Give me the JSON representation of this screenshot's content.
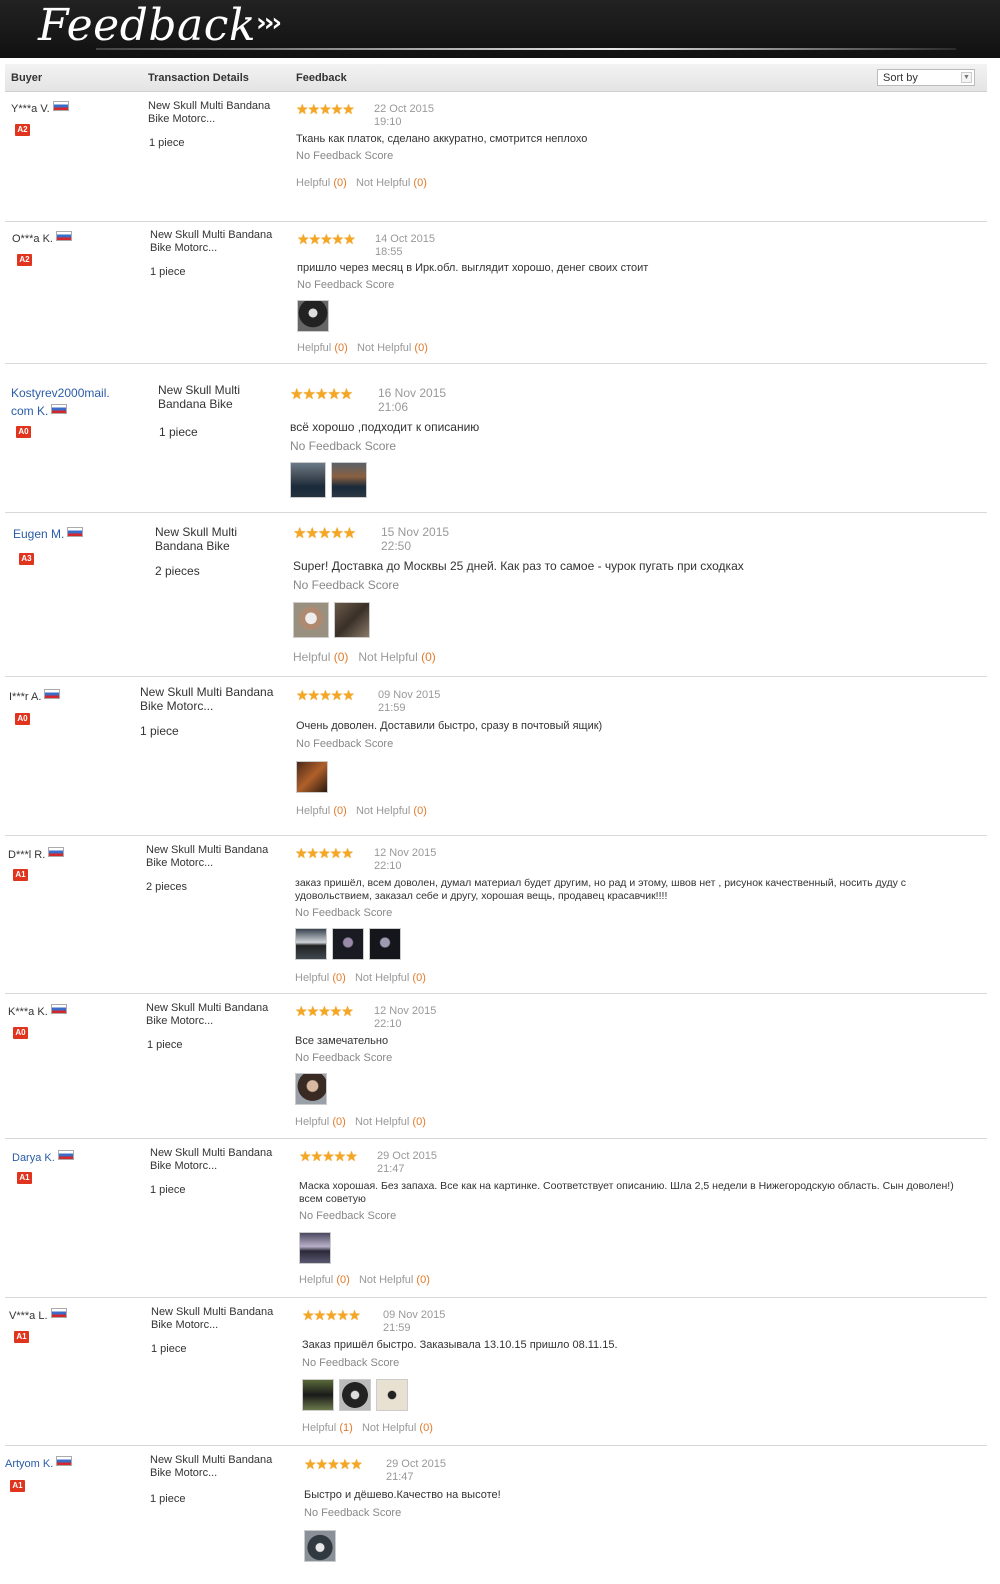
{
  "banner": {
    "title": "Feedback",
    "arrows": "›››"
  },
  "table_header": {
    "buyer": "Buyer",
    "transaction": "Transaction Details",
    "feedback": "Feedback",
    "sort": "Sort by"
  },
  "stars": "★★★★★",
  "helpful_label": "Helpful",
  "not_helpful_label": "Not Helpful",
  "reviews": [
    {
      "buyer": "Y***a V.",
      "level": "A2",
      "product": "New Skull Multi Bandana Bike Motorc...",
      "qty": "1 piece",
      "date": "22 Oct 2015",
      "time": "19:10",
      "comment": "Ткань как платок, сделано аккуратно, смотрится неплохо",
      "score": "No Feedback Score",
      "helpful": "(0)",
      "not_helpful": "(0)"
    },
    {
      "buyer": "O***a K.",
      "level": "A2",
      "product": "New Skull Multi Bandana Bike Motorc...",
      "qty": "1 piece",
      "date": "14 Oct 2015",
      "time": "18:55",
      "comment": "пришло через месяц в Ирк.обл. выглядит хорошо, денег своих стоит",
      "score": "No Feedback Score",
      "helpful": "(0)",
      "not_helpful": "(0)"
    },
    {
      "buyer": "Kostyrev2000mail.",
      "buyer2": "com K.",
      "level": "A0",
      "product": "New Skull Multi Bandana Bike",
      "qty": "1 piece",
      "date": "16 Nov 2015",
      "time": "21:06",
      "comment": "всё хорошо ,подходит к описанию",
      "score": "No Feedback Score",
      "helpful": "",
      "not_helpful": ""
    },
    {
      "buyer": "Eugen M.",
      "level": "A3",
      "product": "New Skull Multi Bandana Bike",
      "qty": "2 pieces",
      "date": "15 Nov 2015",
      "time": "22:50",
      "comment": "Super! Доставка до Москвы 25 дней. Как раз то самое - чурок пугать при сходках",
      "score": "No Feedback Score",
      "helpful": "(0)",
      "not_helpful": "(0)"
    },
    {
      "buyer": "I***r A.",
      "level": "A0",
      "product": "New Skull Multi Bandana Bike Motorc...",
      "qty": "1 piece",
      "date": "09 Nov 2015",
      "time": "21:59",
      "comment": "Очень доволен. Доставили быстро, сразу в почтовый ящик)",
      "score": "No Feedback Score",
      "helpful": "(0)",
      "not_helpful": "(0)"
    },
    {
      "buyer": "D***l R.",
      "level": "A1",
      "product": "New Skull Multi Bandana Bike Motorc...",
      "qty": "2 pieces",
      "date": "12 Nov 2015",
      "time": "22:10",
      "comment": "заказ пришёл, всем доволен, думал материал будет другим, но рад и этому, швов нет , рисунок качественный, носить дуду с удовольствием, заказал себе и другу, хорошая вещь, продавец красавчик!!!!",
      "score": "No Feedback Score",
      "helpful": "(0)",
      "not_helpful": "(0)"
    },
    {
      "buyer": "K***a K.",
      "level": "A0",
      "product": "New Skull Multi Bandana Bike Motorc...",
      "qty": "1 piece",
      "date": "12 Nov 2015",
      "time": "22:10",
      "comment": "Все замечательно",
      "score": "No Feedback Score",
      "helpful": "(0)",
      "not_helpful": "(0)"
    },
    {
      "buyer": "Darya K.",
      "level": "A1",
      "product": "New Skull Multi Bandana Bike Motorc...",
      "qty": "1 piece",
      "date": "29 Oct 2015",
      "time": "21:47",
      "comment": "Маска хорошая. Без запаха. Все как на картинке. Соответствует описанию. Шла 2,5 недели в Нижегородскую область. Сын доволен!) всем советую",
      "score": "No Feedback Score",
      "helpful": "(0)",
      "not_helpful": "(0)"
    },
    {
      "buyer": "V***a L.",
      "level": "A1",
      "product": "New Skull Multi Bandana Bike Motorc...",
      "qty": "1 piece",
      "date": "09 Nov 2015",
      "time": "21:59",
      "comment": "Заказ пришёл быстро. Заказывала 13.10.15 пришло 08.11.15.",
      "score": "No Feedback Score",
      "helpful": "(1)",
      "not_helpful": "(0)"
    },
    {
      "buyer": "Artyom K.",
      "level": "A1",
      "product": "New Skull Multi Bandana Bike Motorc...",
      "qty": "1 piece",
      "date": "29 Oct 2015",
      "time": "21:47",
      "comment": "Быстро и дёшево.Качество на высоте!",
      "score": "No Feedback Score",
      "helpful": "",
      "not_helpful": ""
    }
  ]
}
